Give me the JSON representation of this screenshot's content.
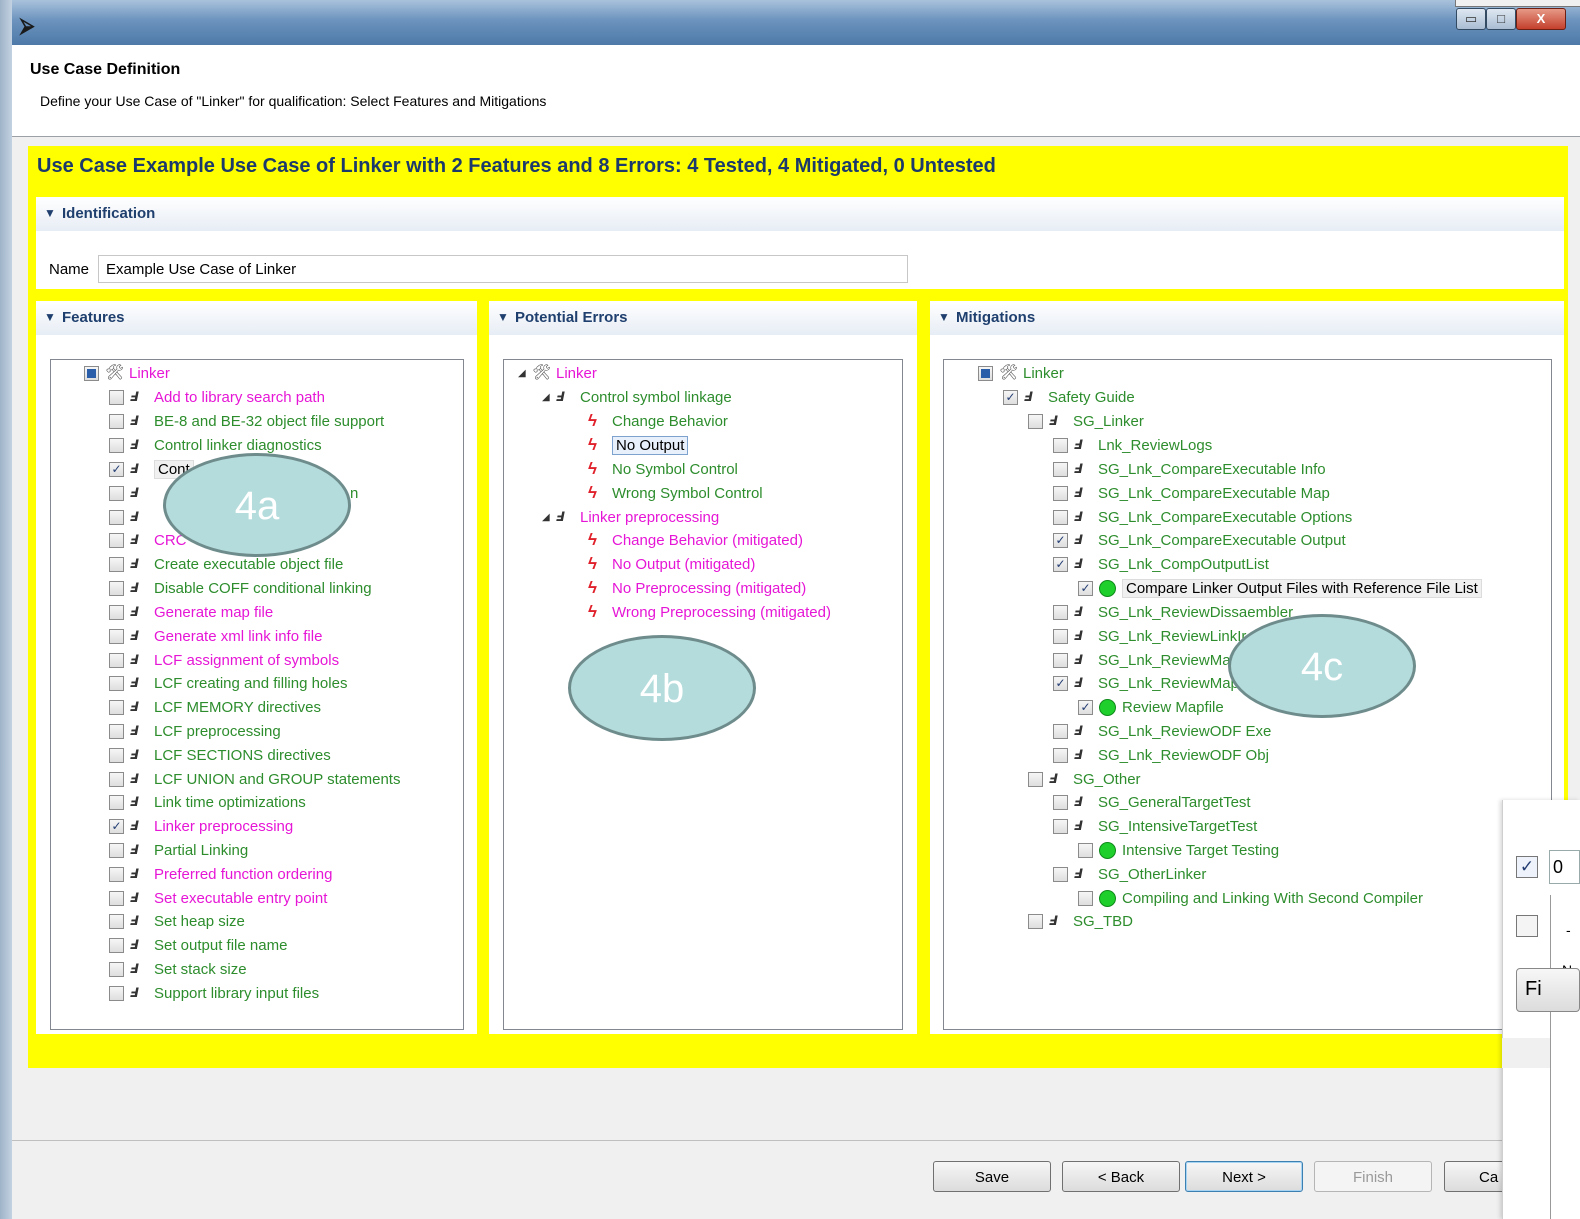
{
  "window": {
    "app_icon": "wizard-arrow-icon",
    "controls": {
      "minimize": "▭",
      "maximize": "□",
      "close": "X"
    }
  },
  "header": {
    "title": "Use Case Definition",
    "description": "Define your Use Case of \"Linker\" for qualification: Select Features and Mitigations"
  },
  "summary": "Use Case Example Use Case of Linker with 2 Features and 8 Errors: 4 Tested, 4 Mitigated, 0 Untested",
  "identification": {
    "title": "Identification",
    "name_label": "Name",
    "name_value": "Example Use Case of Linker"
  },
  "features": {
    "title": "Features",
    "root": "Linker",
    "items": [
      {
        "label": "Add to library search path",
        "checked": false,
        "color": "magenta"
      },
      {
        "label": "BE-8 and BE-32 object file support",
        "checked": false,
        "color": "green"
      },
      {
        "label": "Control linker diagnostics",
        "checked": false,
        "color": "green"
      },
      {
        "label": "Cont",
        "checked": true,
        "color": "black",
        "highlighted": true
      },
      {
        "label": "n",
        "checked": false,
        "color": "green"
      },
      {
        "label": "",
        "checked": false,
        "color": "magenta"
      },
      {
        "label": "CRC",
        "checked": false,
        "color": "magenta"
      },
      {
        "label": "Create executable object file",
        "checked": false,
        "color": "green"
      },
      {
        "label": "Disable COFF conditional linking",
        "checked": false,
        "color": "green"
      },
      {
        "label": "Generate map file",
        "checked": false,
        "color": "magenta"
      },
      {
        "label": "Generate xml link info file",
        "checked": false,
        "color": "magenta"
      },
      {
        "label": "LCF assignment of symbols",
        "checked": false,
        "color": "magenta"
      },
      {
        "label": "LCF creating and filling holes",
        "checked": false,
        "color": "green"
      },
      {
        "label": "LCF MEMORY directives",
        "checked": false,
        "color": "green"
      },
      {
        "label": "LCF preprocessing",
        "checked": false,
        "color": "green"
      },
      {
        "label": "LCF SECTIONS directives",
        "checked": false,
        "color": "green"
      },
      {
        "label": "LCF UNION and GROUP statements",
        "checked": false,
        "color": "green"
      },
      {
        "label": "Link time optimizations",
        "checked": false,
        "color": "green"
      },
      {
        "label": "Linker preprocessing",
        "checked": true,
        "color": "magenta"
      },
      {
        "label": "Partial Linking",
        "checked": false,
        "color": "green"
      },
      {
        "label": "Preferred function ordering",
        "checked": false,
        "color": "magenta"
      },
      {
        "label": "Set executable entry point",
        "checked": false,
        "color": "magenta"
      },
      {
        "label": "Set heap size",
        "checked": false,
        "color": "green"
      },
      {
        "label": "Set output file name",
        "checked": false,
        "color": "green"
      },
      {
        "label": "Set stack size",
        "checked": false,
        "color": "green"
      },
      {
        "label": "Support library input files",
        "checked": false,
        "color": "green"
      }
    ]
  },
  "errors": {
    "title": "Potential Errors",
    "root": "Linker",
    "groups": [
      {
        "label": "Control symbol linkage",
        "items": [
          "Change Behavior",
          "No Output",
          "No Symbol Control",
          "Wrong Symbol Control"
        ]
      },
      {
        "label": "Linker preprocessing",
        "items": [
          "Change Behavior (mitigated)",
          "No Output (mitigated)",
          "No Preprocessing (mitigated)",
          "Wrong Preprocessing (mitigated)"
        ]
      }
    ]
  },
  "mitigations": {
    "title": "Mitigations",
    "items": [
      "Linker",
      "Safety Guide",
      "SG_Linker",
      "Lnk_ReviewLogs",
      "SG_Lnk_CompareExecutable Info",
      "SG_Lnk_CompareExecutable Map",
      "SG_Lnk_CompareExecutable Options",
      "SG_Lnk_CompareExecutable Output",
      "SG_Lnk_CompOutputList",
      "Compare Linker Output Files with Reference File List",
      "SG_Lnk_ReviewDissaembler",
      "SG_Lnk_ReviewLinkIr",
      "SG_Lnk_ReviewMa",
      "SG_Lnk_ReviewMap",
      "Review Mapfile",
      "SG_Lnk_ReviewODF Exe",
      "SG_Lnk_ReviewODF Obj",
      "SG_Other",
      "SG_GeneralTargetTest",
      "SG_IntensiveTargetTest",
      "Intensive Target Testing",
      "SG_OtherLinker",
      "Compiling and Linking With Second Compiler",
      "SG_TBD"
    ]
  },
  "annotations": {
    "a": "4a",
    "b": "4b",
    "c": "4c"
  },
  "buttons": {
    "save": "Save",
    "back": "< Back",
    "next": "Next >",
    "finish": "Finish",
    "cancel": "Ca"
  },
  "overlay": {
    "input_value": "0",
    "frag_a": "-",
    "frag_b": "N",
    "button": "Fi"
  },
  "colors": {
    "highlight": "#ffff00",
    "summary_text": "#1b3a6b",
    "green_item": "#2d8d2d",
    "magenta_item": "#e616d6",
    "error_icon": "#e0202a",
    "mitigation_icon": "#1fcf2c",
    "annotation_fill": "#b5dcdc"
  }
}
